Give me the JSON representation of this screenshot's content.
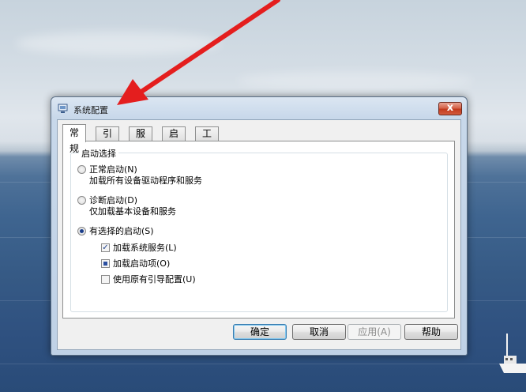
{
  "dialog": {
    "title": "系统配置",
    "close_label": "x"
  },
  "tabs": [
    {
      "label": "常规"
    },
    {
      "label": "引导"
    },
    {
      "label": "服务"
    },
    {
      "label": "启动"
    },
    {
      "label": "工具"
    }
  ],
  "startup_group": {
    "legend": "启动选择",
    "options": [
      {
        "label": "正常启动(N)",
        "description": "加载所有设备驱动程序和服务",
        "selected": false
      },
      {
        "label": "诊断启动(D)",
        "description": "仅加载基本设备和服务",
        "selected": false
      },
      {
        "label": "有选择的启动(S)",
        "description": "",
        "selected": true
      }
    ],
    "checks": [
      {
        "label": "加载系统服务(L)",
        "state": "checked"
      },
      {
        "label": "加载启动项(O)",
        "state": "indeterminate"
      },
      {
        "label": "使用原有引导配置(U)",
        "state": "unchecked"
      }
    ]
  },
  "buttons": {
    "ok": "确定",
    "cancel": "取消",
    "apply": "应用(A)",
    "help": "帮助"
  },
  "colors": {
    "arrow": "#e41e1e",
    "close_button": "#c9432a"
  },
  "icons": [
    "app-config-icon",
    "close-icon",
    "pointer-arrow"
  ]
}
